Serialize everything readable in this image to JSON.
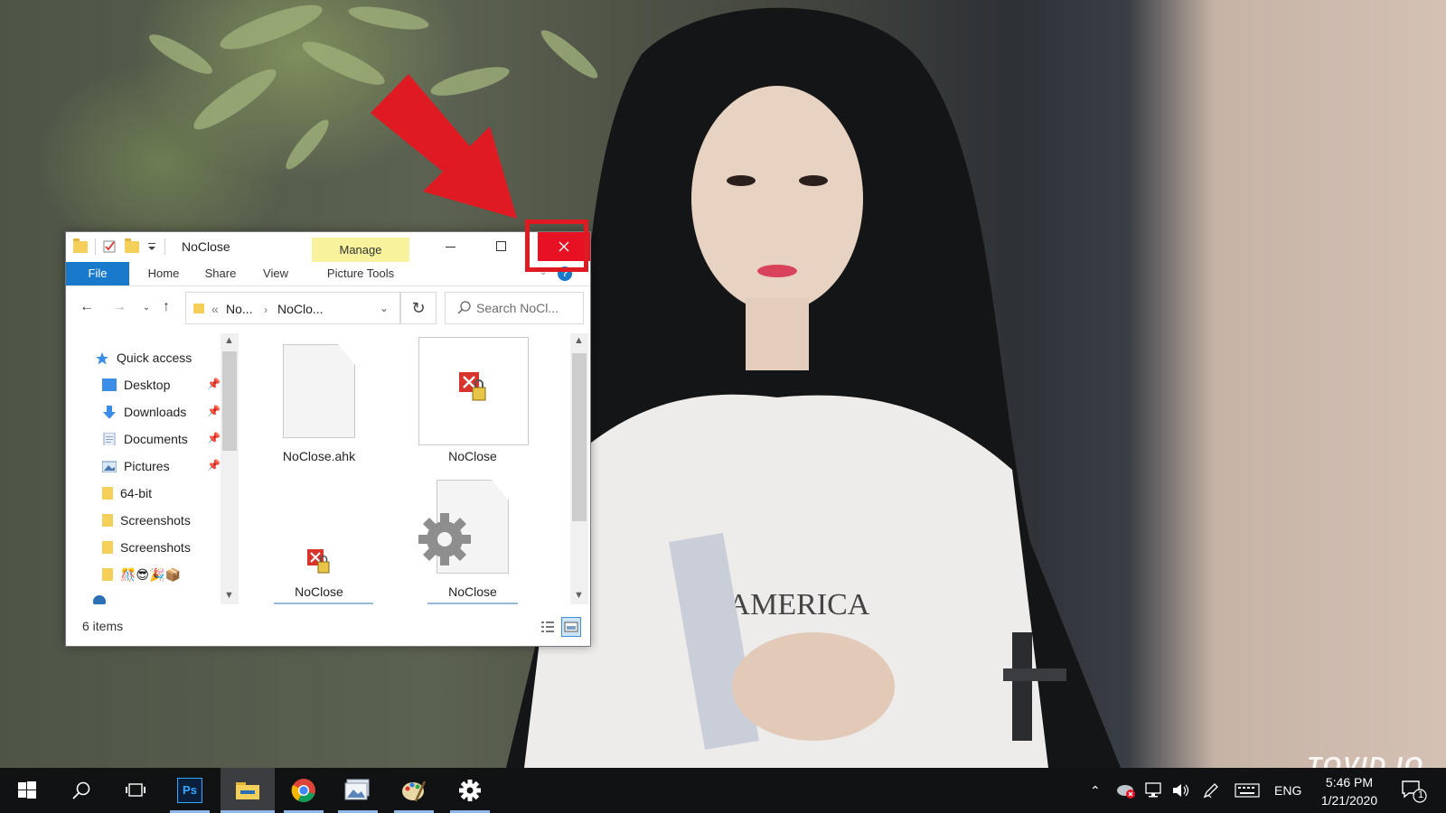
{
  "window": {
    "title": "NoClose",
    "manage_tab": "Manage",
    "ribbon_tabs": {
      "file": "File",
      "home": "Home",
      "share": "Share",
      "view": "View",
      "picture_tools": "Picture Tools"
    },
    "address": {
      "overflow": "«",
      "crumbs": [
        "No...",
        "NoClo..."
      ]
    },
    "search_placeholder": "Search NoCl...",
    "status": "6 items"
  },
  "nav_pane": {
    "items": [
      {
        "label": "Quick access",
        "icon": "star-icon"
      },
      {
        "label": "Desktop",
        "icon": "desktop-icon",
        "pinned": true
      },
      {
        "label": "Downloads",
        "icon": "download-icon",
        "pinned": true
      },
      {
        "label": "Documents",
        "icon": "documents-icon",
        "pinned": true
      },
      {
        "label": "Pictures",
        "icon": "pictures-icon",
        "pinned": true
      },
      {
        "label": "64-bit",
        "icon": "folder-icon"
      },
      {
        "label": "Screenshots",
        "icon": "folder-icon"
      },
      {
        "label": "Screenshots",
        "icon": "folder-icon"
      },
      {
        "label": "🎊😎🎉📦",
        "icon": "folder-icon"
      }
    ]
  },
  "files": [
    {
      "name": "NoClose.ahk",
      "type": "document"
    },
    {
      "name": "NoClose",
      "type": "locked-executable",
      "selected_frame": true
    },
    {
      "name": "NoClose",
      "type": "locked-executable"
    },
    {
      "name": "NoClose",
      "type": "settings-document"
    }
  ],
  "taskbar": {
    "apps": [
      "start-icon",
      "search-icon",
      "task-view-icon",
      "photoshop-icon",
      "file-explorer-icon",
      "chrome-icon",
      "photos-icon",
      "paint-icon",
      "settings-icon"
    ],
    "photoshop_label": "Ps",
    "language": "ENG",
    "time": "5:46 PM",
    "date": "1/21/2020",
    "notification_count": "1"
  },
  "watermark": "TOVID.IO",
  "colors": {
    "accent": "#1979ca",
    "close_red": "#e81123",
    "annotation_red": "#e01a22",
    "manage_yellow": "#f7f29b"
  }
}
